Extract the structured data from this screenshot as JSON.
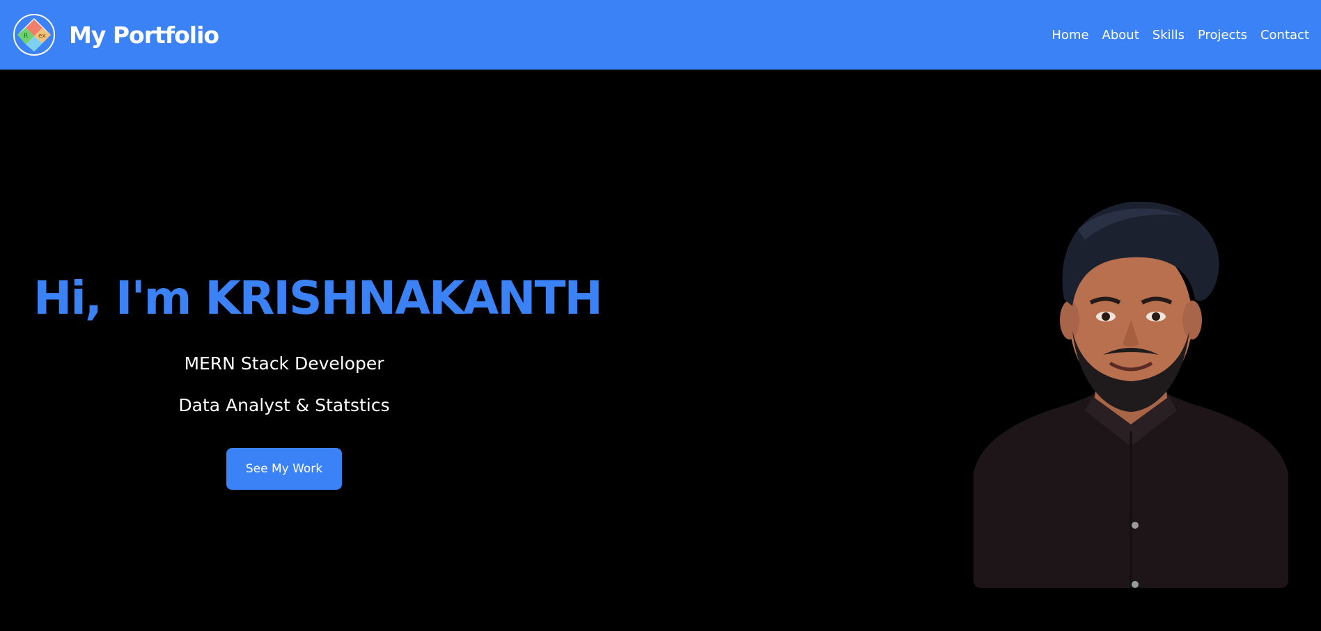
{
  "header": {
    "brand_title": "My Portfolio",
    "logo_letters": [
      "R",
      "ex"
    ],
    "nav": [
      {
        "label": "Home"
      },
      {
        "label": "About"
      },
      {
        "label": "Skills"
      },
      {
        "label": "Projects"
      },
      {
        "label": "Contact"
      }
    ]
  },
  "hero": {
    "title": "Hi, I'm KRISHNAKANTH",
    "roles": [
      "MERN Stack Developer",
      "Data Analyst & Statstics"
    ],
    "cta_label": "See My Work",
    "photo_icon": "profile-photo"
  },
  "colors": {
    "accent": "#3b82f6",
    "background": "#000000",
    "text": "#ffffff"
  }
}
